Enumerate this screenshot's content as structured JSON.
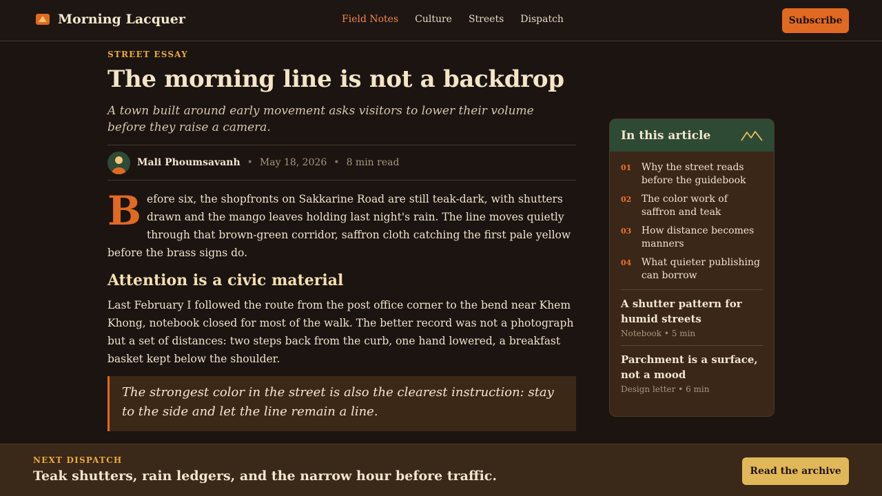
{
  "header": {
    "brand_name": "Morning Lacquer",
    "nav": [
      {
        "label": "Field Notes",
        "active": true
      },
      {
        "label": "Culture",
        "active": false
      },
      {
        "label": "Streets",
        "active": false
      },
      {
        "label": "Dispatch",
        "active": false
      }
    ],
    "subscribe_label": "Subscribe"
  },
  "article": {
    "kicker": "STREET ESSAY",
    "headline": "The morning line is not a backdrop",
    "dek": "A town built around early movement asks visitors to lower their volume before they raise a camera.",
    "author": "Mali Phoumsavanh",
    "date": "May 18, 2026",
    "read_time": "8 min read",
    "dropcap": "B",
    "lead": "efore six, the shopfronts on Sakkarine Road are still teak-dark, with shutters drawn and the mango leaves holding last night's rain. The line moves quietly through that brown-green corridor, saffron cloth catching the first pale yellow before the brass signs do.",
    "section_heading": "Attention is a civic material",
    "body": "Last February I followed the route from the post office corner to the bend near Khem Khong, notebook closed for most of the walk. The better record was not a photograph but a set of distances: two steps back from the curb, one hand lowered, a breakfast basket kept below the shoulder.",
    "pull_quote": "The strongest color in the street is also the clearest instruction: stay to the side and let the line remain a line."
  },
  "toc": {
    "title": "In this article",
    "items": [
      {
        "num": "01",
        "text": "Why the street reads before the guidebook"
      },
      {
        "num": "02",
        "text": "The color work of saffron and teak"
      },
      {
        "num": "03",
        "text": "How distance becomes manners"
      },
      {
        "num": "04",
        "text": "What quieter publishing can borrow"
      }
    ],
    "related": [
      {
        "title": "A shutter pattern for humid streets",
        "meta": "Notebook • 5 min"
      },
      {
        "title": "Parchment is a surface, not a mood",
        "meta": "Design letter • 6 min"
      }
    ]
  },
  "dispatch": {
    "kicker": "NEXT DISPATCH",
    "title": "Teak shutters, rain ledgers, and the narrow hour before traffic.",
    "button_label": "Read the archive"
  },
  "colors": {
    "accent": "#e06a22",
    "gold": "#e9ab3f",
    "green": "#2e4a35",
    "background": "#1c1410"
  }
}
